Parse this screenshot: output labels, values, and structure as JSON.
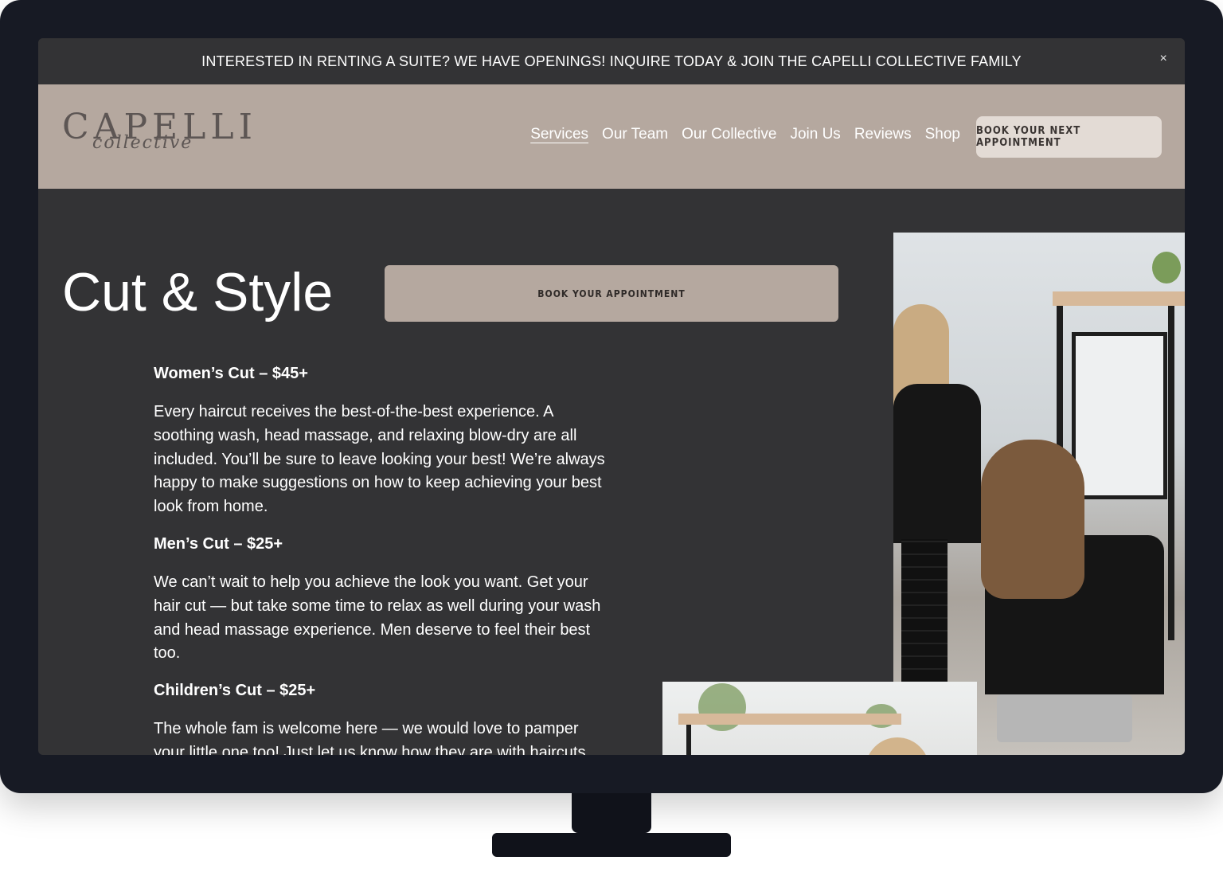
{
  "announcement": {
    "text": "INTERESTED IN RENTING A SUITE? WE HAVE OPENINGS! INQUIRE TODAY & JOIN THE CAPELLI COLLECTIVE FAMILY",
    "close_label": "×"
  },
  "header": {
    "logo_word": "CAPELLI",
    "logo_script": "collective",
    "nav": [
      {
        "label": "Services"
      },
      {
        "label": "Our Team"
      },
      {
        "label": "Our Collective"
      },
      {
        "label": "Join Us"
      },
      {
        "label": "Reviews"
      },
      {
        "label": "Shop"
      }
    ],
    "cta": "BOOK YOUR NEXT APPOINTMENT"
  },
  "main": {
    "title": "Cut & Style",
    "book_button": "BOOK YOUR APPOINTMENT",
    "services": [
      {
        "heading": "Women’s Cut – $45+",
        "description": "Every haircut receives the best-of-the-best experience. A soothing wash, head massage, and relaxing blow-dry are all included. You’ll be sure to leave looking your best! We’re always happy to make suggestions on how to keep achieving your best look from home."
      },
      {
        "heading": "Men’s Cut – $25+",
        "description": "We can’t wait to help you achieve the look you want. Get your hair cut — but take some time to relax as well during your wash and head massage experience. Men deserve to feel their best too."
      },
      {
        "heading": "Children’s Cut – $25+",
        "description": "The whole fam is welcome here — we would love to pamper your little one too! Just let us know how they are with haircuts,"
      }
    ]
  },
  "colors": {
    "page_bg": "#333335",
    "header_bg": "#b5a89f",
    "header_cta_bg": "#e3dbd5",
    "frame": "#171a24"
  }
}
